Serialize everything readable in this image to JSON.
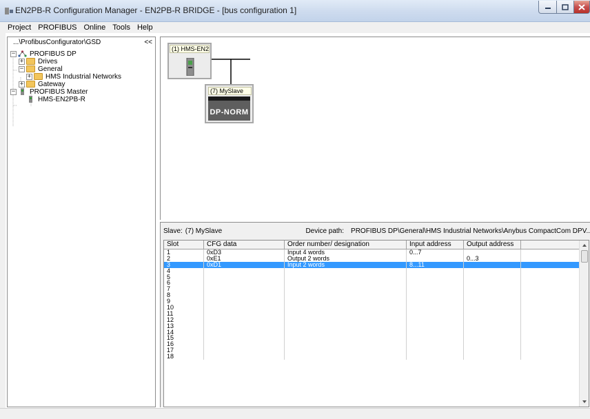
{
  "window": {
    "title": "EN2PB-R Configuration Manager - EN2PB-R BRIDGE - [bus configuration 1]"
  },
  "menu": [
    "Project",
    "PROFIBUS",
    "Online",
    "Tools",
    "Help"
  ],
  "tree": {
    "path": "...\\ProfibusConfigurator\\GSD",
    "collapse_label": "<<",
    "nodes": [
      {
        "label": "PROFIBUS DP",
        "expander": "−"
      },
      {
        "label": "Drives",
        "expander": "+"
      },
      {
        "label": "General",
        "expander": "−"
      },
      {
        "label": "HMS Industrial Networks",
        "expander": "+"
      },
      {
        "label": "Gateway",
        "expander": "+"
      },
      {
        "label": "PROFIBUS Master",
        "expander": "−"
      },
      {
        "label": "HMS-EN2PB-R",
        "expander": ""
      }
    ]
  },
  "canvas": {
    "master_label": "(1) HMS-EN2",
    "slave_label": "(7) MySlave",
    "slave_box": "DP-NORM"
  },
  "detail": {
    "slave_label": "Slave:",
    "slave_value": "(7) MySlave",
    "device_path_label": "Device path:",
    "device_path_value": "PROFIBUS DP\\General\\HMS Industrial Networks\\Anybus CompactCom DPV.."
  },
  "grid": {
    "columns": [
      "Slot",
      "CFG data",
      "Order number/ designation",
      "Input address",
      "Output address",
      ""
    ],
    "rows": [
      [
        "1",
        "0xD3",
        "Input 4 words",
        "0...7",
        ""
      ],
      [
        "2",
        "0xE1",
        "Output 2 words",
        "",
        "0...3"
      ],
      [
        "3",
        "0xD1",
        "Input 2 words",
        "8...11",
        ""
      ],
      [
        "4",
        "",
        "",
        "",
        ""
      ],
      [
        "5",
        "",
        "",
        "",
        ""
      ],
      [
        "6",
        "",
        "",
        "",
        ""
      ],
      [
        "7",
        "",
        "",
        "",
        ""
      ],
      [
        "8",
        "",
        "",
        "",
        ""
      ],
      [
        "9",
        "",
        "",
        "",
        ""
      ],
      [
        "10",
        "",
        "",
        "",
        ""
      ],
      [
        "11",
        "",
        "",
        "",
        ""
      ],
      [
        "12",
        "",
        "",
        "",
        ""
      ],
      [
        "13",
        "",
        "",
        "",
        ""
      ],
      [
        "14",
        "",
        "",
        "",
        ""
      ],
      [
        "15",
        "",
        "",
        "",
        ""
      ],
      [
        "16",
        "",
        "",
        "",
        ""
      ],
      [
        "17",
        "",
        "",
        "",
        ""
      ],
      [
        "18",
        "",
        "",
        "",
        ""
      ]
    ],
    "selected_row": 3
  },
  "colors": {
    "selection": "#3399ff",
    "dp_box": "#5e5e5e"
  }
}
